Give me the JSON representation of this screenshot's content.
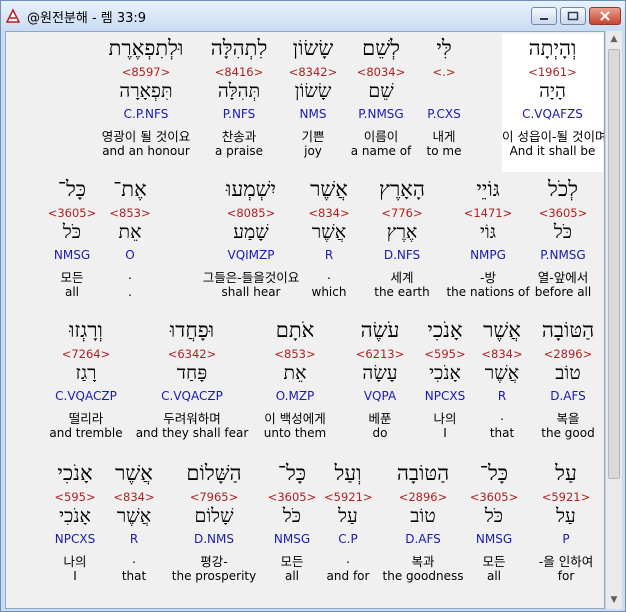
{
  "window": {
    "title": "@원전분해 - 렘 33:9"
  },
  "lines": [
    {
      "words": [
        {
          "hebrew": "וְהָיְתָה",
          "strong": "<1961>",
          "lemma": "הָיָה",
          "morph": "C.VQAFZS",
          "korean": "이 성읍이-될 것이며",
          "english": "And it shall be",
          "highlight": true
        },
        {
          "hebrew": "לִּי",
          "strong": "<.>",
          "lemma": "",
          "morph": "P.CXS",
          "korean": "내게",
          "english": "to me"
        },
        {
          "hebrew": "לְשֵׁם",
          "strong": "<8034>",
          "lemma": "שֵׁם",
          "morph": "P.NMSG",
          "korean": "이름이",
          "english": "a name of"
        },
        {
          "hebrew": "שָׂשׂוֹן",
          "strong": "<8342>",
          "lemma": "שָׂשׂוֹן",
          "morph": "NMS",
          "korean": "기쁜",
          "english": "joy"
        },
        {
          "hebrew": "לִתְהִלָּה",
          "strong": "<8416>",
          "lemma": "תְּהִלָּה",
          "morph": "P.NFS",
          "korean": "찬송과",
          "english": "a praise"
        },
        {
          "hebrew": "וּלְתִפְאֶרֶת",
          "strong": "<8597>",
          "lemma": "תִּפְאָרָה",
          "morph": "C.P.NFS",
          "korean": "영광이 될 것이요",
          "english": "and an honour"
        }
      ]
    },
    {
      "words": [
        {
          "hebrew": "לְכֹל",
          "strong": "<3605>",
          "lemma": "כֹּל",
          "morph": "P.NMSG",
          "korean": "열-앞에서",
          "english": "before all"
        },
        {
          "hebrew": "גּוֹיֵי",
          "strong": "<1471>",
          "lemma": "גּוֹי",
          "morph": "NMPG",
          "korean": "-방",
          "english": "the nations of"
        },
        {
          "hebrew": "הָאָרֶץ",
          "strong": "<776>",
          "lemma": "אֶרֶץ",
          "morph": "D.NFS",
          "korean": "세계",
          "english": "the earth"
        },
        {
          "hebrew": "אֲשֶׁר",
          "strong": "<834>",
          "lemma": "אֲשֶׁר",
          "morph": "R",
          "korean": ".",
          "english": "which"
        },
        {
          "hebrew": "יִשְׁמְעוּ",
          "strong": "<8085>",
          "lemma": "שָׁמַע",
          "morph": "VQIMZP",
          "korean": "그들은-들을것이요",
          "english": "shall hear"
        },
        {
          "hebrew": "אֶת־",
          "strong": "<853>",
          "lemma": "אֵת",
          "morph": "O",
          "korean": ".",
          "english": "."
        },
        {
          "hebrew": "כָּל־",
          "strong": "<3605>",
          "lemma": "כֹּל",
          "morph": "NMSG",
          "korean": "모든",
          "english": "all"
        }
      ]
    },
    {
      "words": [
        {
          "hebrew": "הַטּוֹבָה",
          "strong": "<2896>",
          "lemma": "טוֹב",
          "morph": "D.AFS",
          "korean": "복을",
          "english": "the good"
        },
        {
          "hebrew": "אֲשֶׁר",
          "strong": "<834>",
          "lemma": "אֲשֶׁר",
          "morph": "R",
          "korean": ".",
          "english": "that"
        },
        {
          "hebrew": "אָנֹכִי",
          "strong": "<595>",
          "lemma": "אָנֹכִי",
          "morph": "NPCXS",
          "korean": "나의",
          "english": "I"
        },
        {
          "hebrew": "עֹשֶׂה",
          "strong": "<6213>",
          "lemma": "עָשָׂה",
          "morph": "VQPA",
          "korean": "베푼",
          "english": "do"
        },
        {
          "hebrew": "אֹתָם",
          "strong": "<853>",
          "lemma": "אֵת",
          "morph": "O.MZP",
          "korean": "이 백성에게",
          "english": "unto them"
        },
        {
          "hebrew": "וּפָחֲדוּ",
          "strong": "<6342>",
          "lemma": "פָּחַד",
          "morph": "C.VQACZP",
          "korean": "두려워하며",
          "english": "and they shall fear"
        },
        {
          "hebrew": "וְרָגְזוּ",
          "strong": "<7264>",
          "lemma": "רָגַז",
          "morph": "C.VQACZP",
          "korean": "떨리라",
          "english": "and tremble"
        }
      ]
    },
    {
      "words": [
        {
          "hebrew": "עַל",
          "strong": "<5921>",
          "lemma": "עַל",
          "morph": "P",
          "korean": "-을 인하여",
          "english": "for"
        },
        {
          "hebrew": "כָּל־",
          "strong": "<3605>",
          "lemma": "כֹּל",
          "morph": "NMSG",
          "korean": "모든",
          "english": "all"
        },
        {
          "hebrew": "הַטּוֹבָה",
          "strong": "<2896>",
          "lemma": "טוֹב",
          "morph": "D.AFS",
          "korean": "복과",
          "english": "the goodness"
        },
        {
          "hebrew": "וְעַל",
          "strong": "<5921>",
          "lemma": "עַל",
          "morph": "C.P",
          "korean": ".",
          "english": "and for"
        },
        {
          "hebrew": "כָּל־",
          "strong": "<3605>",
          "lemma": "כֹּל",
          "morph": "NMSG",
          "korean": "모든",
          "english": "all"
        },
        {
          "hebrew": "הַשָּׁלוֹם",
          "strong": "<7965>",
          "lemma": "שָׁלוֹם",
          "morph": "D.NMS",
          "korean": "평강-",
          "english": "the prosperity"
        },
        {
          "hebrew": "אֲשֶׁר",
          "strong": "<834>",
          "lemma": "אֲשֶׁר",
          "morph": "R",
          "korean": ".",
          "english": "that"
        },
        {
          "hebrew": "אָנֹכִי",
          "strong": "<595>",
          "lemma": "אָנֹכִי",
          "morph": "NPCXS",
          "korean": "나의",
          "english": "I"
        }
      ]
    }
  ],
  "colors": {
    "strong": "#b02020",
    "morph": "#1a1aaf",
    "highlight": "#ffffff"
  }
}
